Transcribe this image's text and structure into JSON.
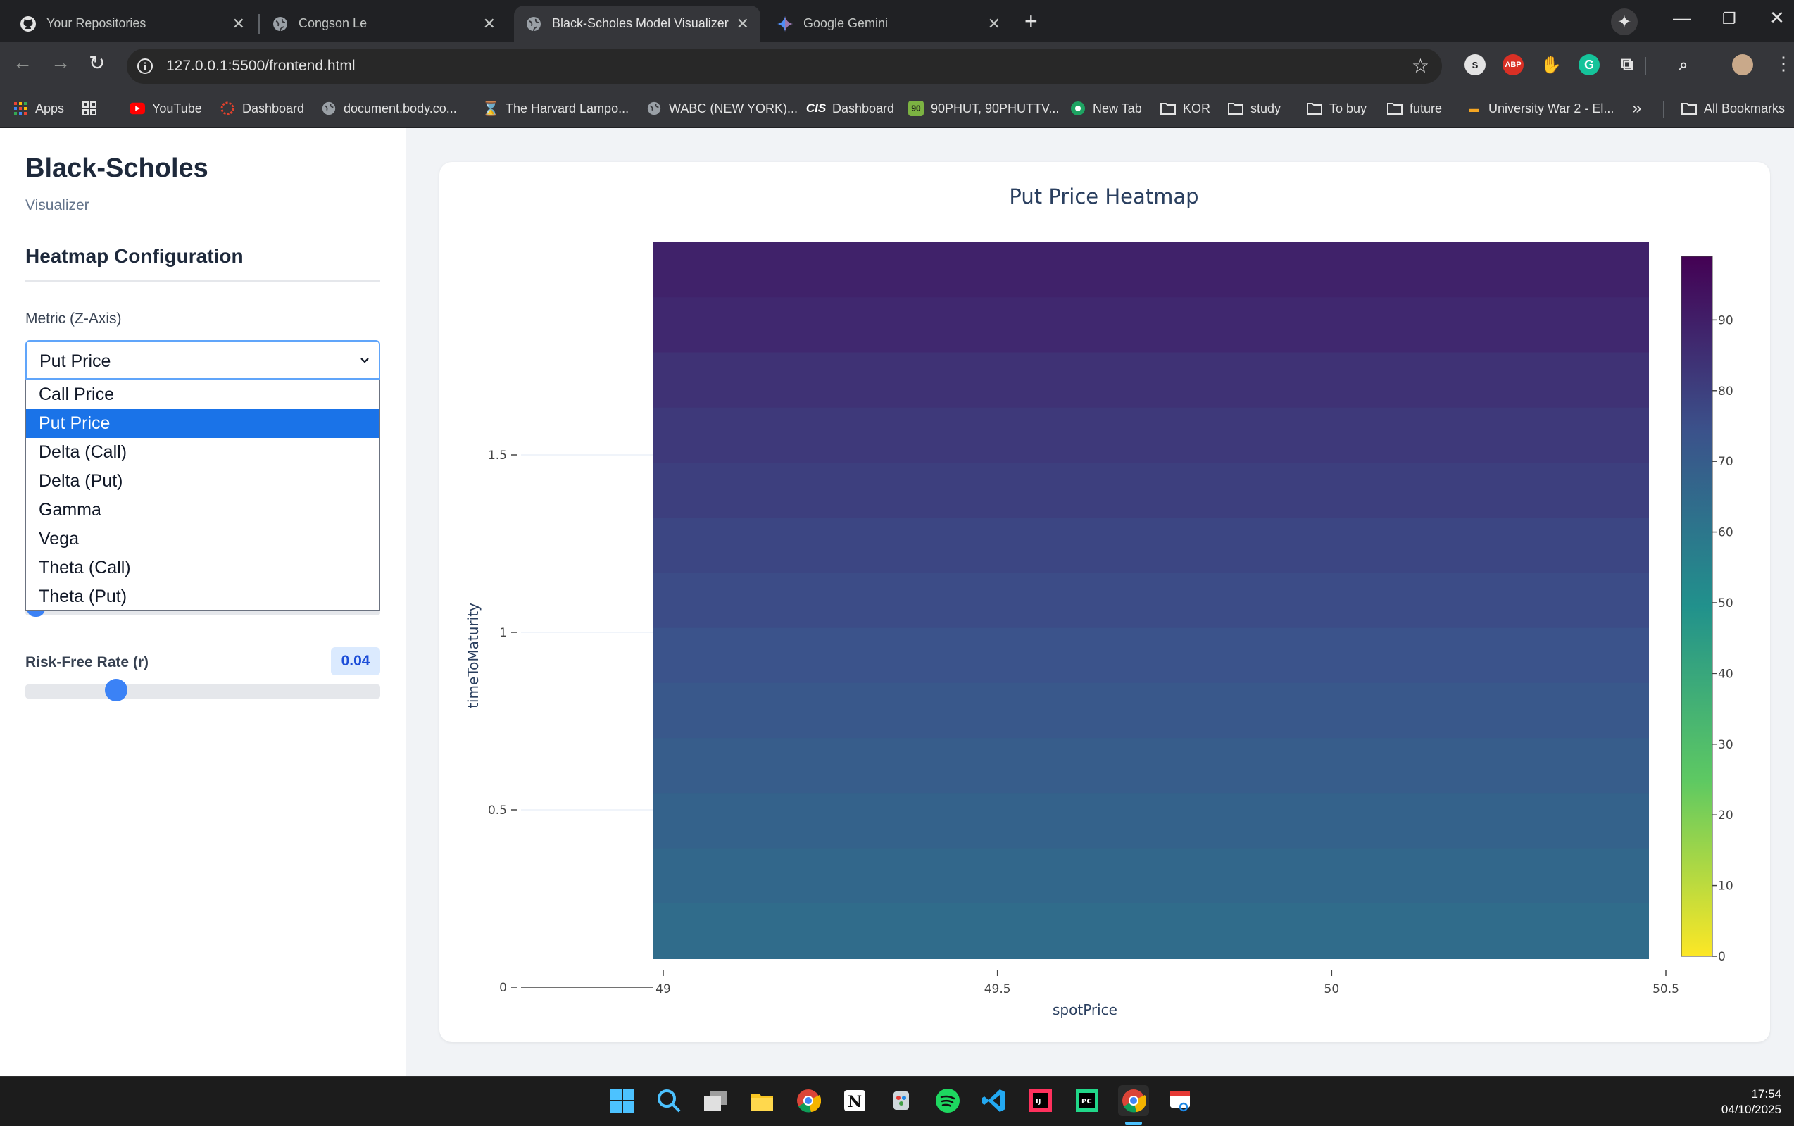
{
  "browser": {
    "tabs": [
      {
        "title": "Your Repositories",
        "icon": "github-icon",
        "active": false
      },
      {
        "title": "Congson Le",
        "icon": "globe-icon",
        "active": false
      },
      {
        "title": "Black-Scholes Model Visualizer",
        "icon": "globe-icon",
        "active": true
      },
      {
        "title": "Google Gemini",
        "icon": "gemini-icon",
        "active": false
      }
    ],
    "url": "127.0.0.1:5500/frontend.html",
    "bookmarks": [
      {
        "label": "Apps",
        "icon": "apps-grid-icon"
      },
      {
        "label": "",
        "icon": "tab-groups-icon"
      },
      {
        "label": "YouTube",
        "icon": "youtube-icon"
      },
      {
        "label": "Dashboard",
        "icon": "canvas-icon"
      },
      {
        "label": "document.body.co...",
        "icon": "globe-icon"
      },
      {
        "label": "The Harvard Lampo...",
        "icon": "lampoon-icon"
      },
      {
        "label": "WABC (NEW YORK)...",
        "icon": "globe-icon"
      },
      {
        "label": "Dashboard",
        "icon": "cis-icon"
      },
      {
        "label": "90PHUT, 90PHUTTV...",
        "icon": "phut-icon"
      },
      {
        "label": "New Tab",
        "icon": "soccer-icon"
      },
      {
        "label": "KOR",
        "icon": "folder-icon"
      },
      {
        "label": "study",
        "icon": "folder-icon"
      },
      {
        "label": "To buy",
        "icon": "folder-icon"
      },
      {
        "label": "future",
        "icon": "folder-icon"
      },
      {
        "label": "University War 2 - El...",
        "icon": "bookmark-icon"
      }
    ],
    "overflow": "»",
    "all_bookmarks": "All Bookmarks"
  },
  "sidebar": {
    "title": "Black-Scholes",
    "subtitle": "Visualizer",
    "section_title": "Heatmap Configuration",
    "metric": {
      "label": "Metric (Z-Axis)",
      "value": "Put Price",
      "options": [
        "Call Price",
        "Put Price",
        "Delta (Call)",
        "Delta (Put)",
        "Gamma",
        "Vega",
        "Theta (Call)",
        "Theta (Put)"
      ],
      "selected_index": 1
    },
    "risk_free_rate": {
      "label": "Risk-Free Rate (r)",
      "value": "0.04",
      "slider_fraction": 0.24
    }
  },
  "chart_data": {
    "type": "heatmap",
    "title": "Put Price Heatmap",
    "xlabel": "spotPrice",
    "ylabel": "timeToMaturity",
    "x_ticks": [
      "49",
      "49.5",
      "50",
      "50.5"
    ],
    "y_ticks": [
      "0",
      "0.5",
      "1",
      "1.5"
    ],
    "xlim": [
      48.8,
      50.74
    ],
    "ylim": [
      0,
      1.98
    ],
    "z_range": [
      0,
      99
    ],
    "z_values_top_to_bottom": [
      89,
      87,
      84,
      82,
      80,
      78,
      76,
      74,
      72,
      70,
      68,
      66,
      64
    ],
    "colorscale": "viridis-reversed",
    "colorbar_ticks": [
      "90",
      "80",
      "70",
      "60",
      "50",
      "40",
      "30",
      "20",
      "10",
      "0"
    ]
  },
  "taskbar": {
    "apps": [
      "windows-start-icon",
      "search-icon",
      "task-view-icon",
      "file-explorer-icon",
      "chrome-icon",
      "notion-icon",
      "paint-icon",
      "spotify-icon",
      "vscode-icon",
      "intellij-icon",
      "pycharm-icon",
      "chrome-active-icon",
      "snipping-tool-icon"
    ],
    "time": "17:54",
    "date": "04/10/2025"
  }
}
